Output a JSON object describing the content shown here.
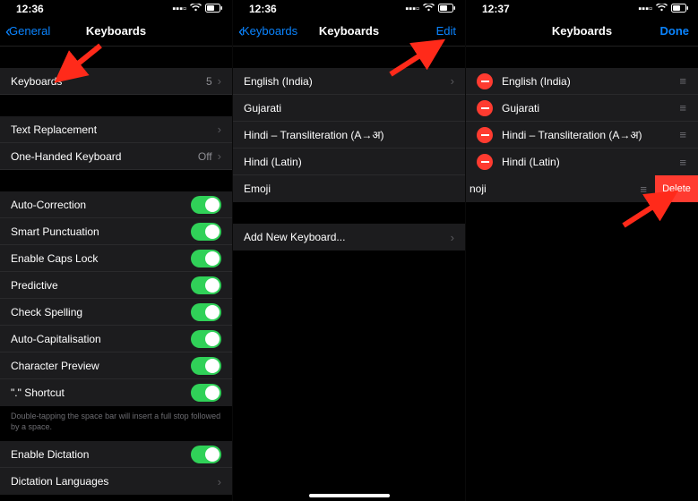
{
  "phone1": {
    "status": {
      "time": "12:36"
    },
    "nav": {
      "back": "General",
      "title": "Keyboards"
    },
    "main": {
      "keyboards_label": "Keyboards",
      "keyboards_count": "5",
      "text_replacement": "Text Replacement",
      "one_handed": "One-Handed Keyboard",
      "one_handed_value": "Off"
    },
    "toggles": [
      "Auto-Correction",
      "Smart Punctuation",
      "Enable Caps Lock",
      "Predictive",
      "Check Spelling",
      "Auto-Capitalisation",
      "Character Preview",
      "\".\" Shortcut"
    ],
    "toggle_note": "Double-tapping the space bar will insert a full stop followed by a space.",
    "dictation": {
      "enable": "Enable Dictation",
      "languages": "Dictation Languages"
    }
  },
  "phone2": {
    "status": {
      "time": "12:36"
    },
    "nav": {
      "back": "Keyboards",
      "title": "Keyboards",
      "edit": "Edit"
    },
    "keyboards": [
      "English (India)",
      "Gujarati",
      "Hindi – Transliteration (A→अ)",
      "Hindi (Latin)",
      "Emoji"
    ],
    "add": "Add New Keyboard..."
  },
  "phone3": {
    "status": {
      "time": "12:37"
    },
    "nav": {
      "title": "Keyboards",
      "done": "Done"
    },
    "keyboards": [
      "English (India)",
      "Gujarati",
      "Hindi – Transliteration (A→अ)",
      "Hindi (Latin)"
    ],
    "swiped": {
      "label": "noji",
      "delete": "Delete"
    }
  }
}
